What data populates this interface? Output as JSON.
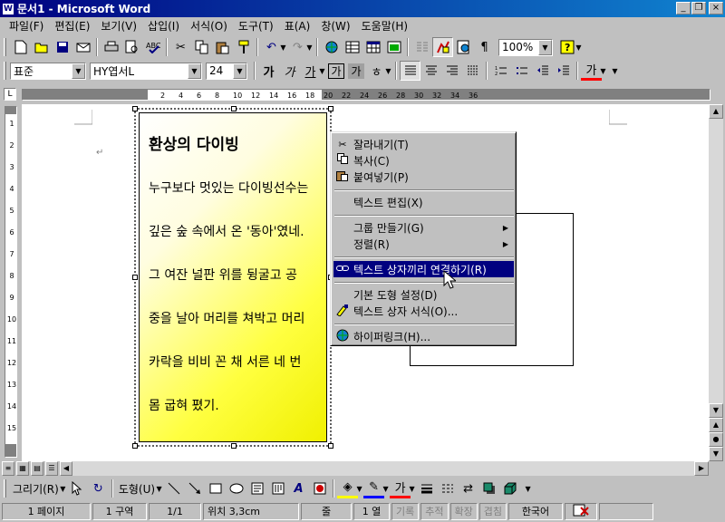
{
  "window": {
    "title": "문서1 - Microsoft Word",
    "app_icon": "W",
    "controls": [
      "_",
      "❐",
      "×"
    ]
  },
  "menubar": [
    "파일(F)",
    "편집(E)",
    "보기(V)",
    "삽입(I)",
    "서식(O)",
    "도구(T)",
    "표(A)",
    "창(W)",
    "도움말(H)"
  ],
  "toolbar1": {
    "zoom": "100%"
  },
  "toolbar2": {
    "style": "표준",
    "font": "HY엽서L",
    "size": "24",
    "glyph_bold": "가",
    "glyph_italic": "가",
    "glyph_underline": "가",
    "glyph_border": "가",
    "glyph_shade": "가",
    "glyph_font_color": "가"
  },
  "ruler": {
    "labels": [
      "2",
      "4",
      "6",
      "8",
      "10",
      "12",
      "14",
      "16",
      "18",
      "20",
      "22",
      "24",
      "26",
      "28",
      "30",
      "32",
      "34",
      "36"
    ]
  },
  "vruler": {
    "labels": [
      "1",
      "2",
      "3",
      "4",
      "5",
      "6",
      "7",
      "8",
      "9",
      "10",
      "11",
      "12",
      "13",
      "14",
      "15"
    ]
  },
  "textbox": {
    "title": "환상의 다이빙",
    "lines": [
      "누구보다 멋있는 다이빙선수는",
      "깊은 숲 속에서 온 '동아'였네.",
      "그 여잔 널판 위를 뒹굴고 공",
      "중을 날아 머리를 쳐박고 머리",
      "카락을 비비 꼰 채 서른 네 번",
      "몸 굽혀 폈기."
    ]
  },
  "context_menu": {
    "items": [
      {
        "label": "잘라내기(T)",
        "icon": "scissors-icon"
      },
      {
        "label": "복사(C)",
        "icon": "copy-icon"
      },
      {
        "label": "붙여넣기(P)",
        "icon": "paste-icon"
      },
      {
        "label": "텍스트 편집(X)",
        "icon": ""
      },
      {
        "label": "그룹 만들기(G)",
        "icon": "",
        "submenu": true
      },
      {
        "label": "정렬(R)",
        "icon": "",
        "submenu": true
      },
      {
        "label": "텍스트 상자끼리 연결하기(R)",
        "icon": "link-icon",
        "highlighted": true
      },
      {
        "label": "기본 도형 설정(D)",
        "icon": ""
      },
      {
        "label": "텍스트 상자 서식(O)...",
        "icon": "format-icon"
      },
      {
        "label": "하이퍼링크(H)...",
        "icon": "hyperlink-icon"
      }
    ]
  },
  "drawbar": {
    "draw": "그리기(R)",
    "autoshapes": "도형(U)"
  },
  "statusbar": {
    "page": "1 페이지",
    "section": "1 구역",
    "pages": "1/1",
    "position": "위치 3,3cm",
    "line": "줄",
    "col": "1 열",
    "rec": "기록",
    "trk": "추적",
    "ext": "확장",
    "ovr": "겹침",
    "lang": "한국어"
  }
}
